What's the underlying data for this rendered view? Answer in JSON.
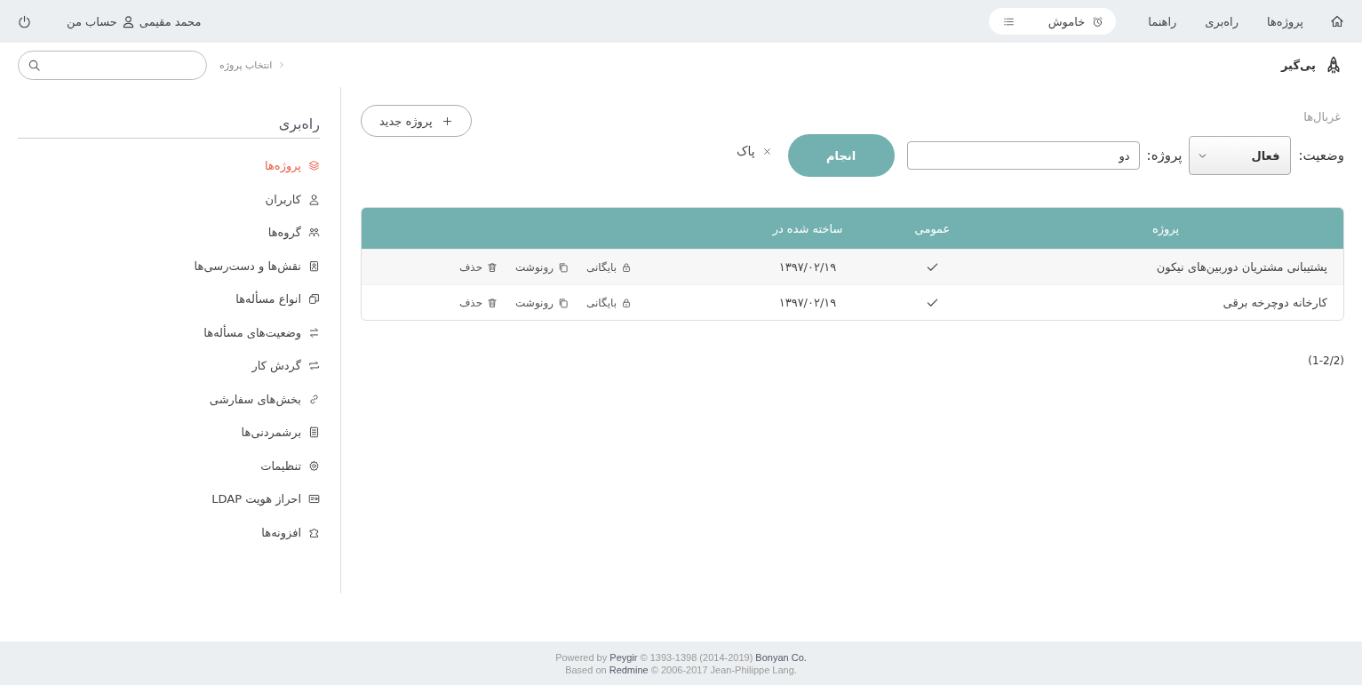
{
  "topbar": {
    "menu": [
      "پروژه‌ها",
      "راه‌بری",
      "راهنما"
    ],
    "timer": {
      "label": "خاموش"
    },
    "user": {
      "name": "محمد مقیمی",
      "account": "حساب من"
    }
  },
  "header": {
    "logo": "پی‌گیر",
    "breadcrumb": "انتخاب پروژه"
  },
  "filters": {
    "legend": "غربال‌ها",
    "status": {
      "label": "وضعیت:",
      "value": "فعال"
    },
    "project": {
      "label": "پروژه:",
      "value": "دو"
    },
    "apply": "انجام",
    "clear": "پاک"
  },
  "new_project": "پروژه جدید",
  "table": {
    "columns": [
      "پروژه",
      "عمومی",
      "ساخته شده در"
    ],
    "rows": [
      {
        "name": "پشتیبانی مشتریان دوربین‌های نیکون",
        "public": true,
        "created": "۱۳۹۷/۰۲/۱۹",
        "actions": [
          "بایگانی",
          "رونوشت",
          "حذف"
        ]
      },
      {
        "name": "کارخانه دوچرخه برقی",
        "public": true,
        "created": "۱۳۹۷/۰۲/۱۹",
        "actions": [
          "بایگانی",
          "رونوشت",
          "حذف"
        ]
      }
    ]
  },
  "pagination": "(1-2/2)",
  "sidebar": {
    "title": "راه‌بری",
    "items": [
      {
        "label": "پروژه‌ها",
        "selected": true
      },
      {
        "label": "کاربران",
        "selected": false
      },
      {
        "label": "گروه‌ها",
        "selected": false
      },
      {
        "label": "نقش‌ها و دست‌رسی‌ها",
        "selected": false
      },
      {
        "label": "انواع مسأله‌ها",
        "selected": false
      },
      {
        "label": "وضعیت‌های مسأله‌ها",
        "selected": false
      },
      {
        "label": "گردش کار",
        "selected": false
      },
      {
        "label": "بخش‌های سفارشی",
        "selected": false
      },
      {
        "label": "برشمردنی‌ها",
        "selected": false
      },
      {
        "label": "تنظیمات",
        "selected": false
      },
      {
        "label": "احراز هویت LDAP",
        "selected": false
      },
      {
        "label": "افزونه‌ها",
        "selected": false
      }
    ]
  },
  "footer": {
    "powered_by": {
      "prefix": "Powered by",
      "product": "Peygir",
      "copyright": "© 1393-1398 (2014-2019)",
      "company": "Bonyan Co."
    },
    "based_on": {
      "prefix": "Based on",
      "engine": "Redmine",
      "credit": "© 2006-2017 Jean-Philippe Lang."
    }
  }
}
